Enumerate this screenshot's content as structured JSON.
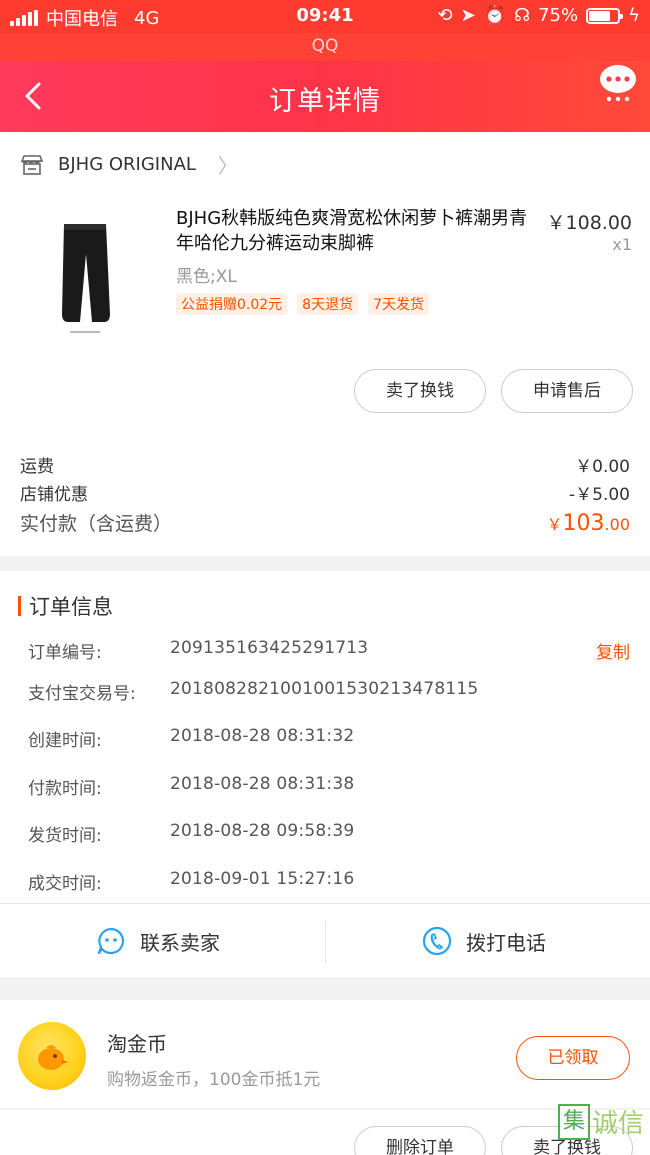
{
  "status_bar": {
    "carrier": "中国电信",
    "network": "4G",
    "time": "09:41",
    "battery": "75%"
  },
  "app_label": "QQ",
  "nav": {
    "title": "订单详情"
  },
  "shop": {
    "name": "BJHG ORIGINAL"
  },
  "product": {
    "title": "BJHG秋韩版纯色爽滑宽松休闲萝卜裤潮男青年哈伦九分裤运动束脚裤",
    "price": "￥108.00",
    "quantity": "x1",
    "sku": "黑色;XL",
    "tags": [
      "公益捐赠0.02元",
      "8天退货",
      "7天发货"
    ]
  },
  "product_actions": {
    "sell_label": "卖了换钱",
    "aftersale_label": "申请售后"
  },
  "fees": {
    "shipping_label": "运费",
    "shipping_value": "￥0.00",
    "discount_label": "店铺优惠",
    "discount_value": "-￥5.00",
    "total_label": "实付款（含运费）",
    "total_currency": "￥",
    "total_integer": "103",
    "total_decimal": ".00"
  },
  "order_info": {
    "title": "订单信息",
    "copy_label": "复制",
    "rows": [
      {
        "label": "订单编号:",
        "value": "209135163425291713"
      },
      {
        "label": "支付宝交易号:",
        "value": "2018082821001001530213478115"
      },
      {
        "label": "创建时间:",
        "value": "2018-08-28 08:31:32"
      },
      {
        "label": "付款时间:",
        "value": "2018-08-28 08:31:38"
      },
      {
        "label": "发货时间:",
        "value": "2018-08-28 09:58:39"
      },
      {
        "label": "成交时间:",
        "value": "2018-09-01 15:27:16"
      }
    ],
    "contact_seller_label": "联系卖家",
    "call_label": "拨打电话"
  },
  "coin": {
    "title": "淘金币",
    "subtitle": "购物返金币，100金币抵1元",
    "button_label": "已领取"
  },
  "bottom_actions": {
    "delete_label": "删除订单",
    "sell_label": "卖了换钱"
  },
  "watermark": {
    "badge": "集",
    "text": "诚信"
  },
  "colors": {
    "accent": "#ff5000",
    "nav_start": "#ff3a5c",
    "status_bar": "#ff3b30"
  }
}
